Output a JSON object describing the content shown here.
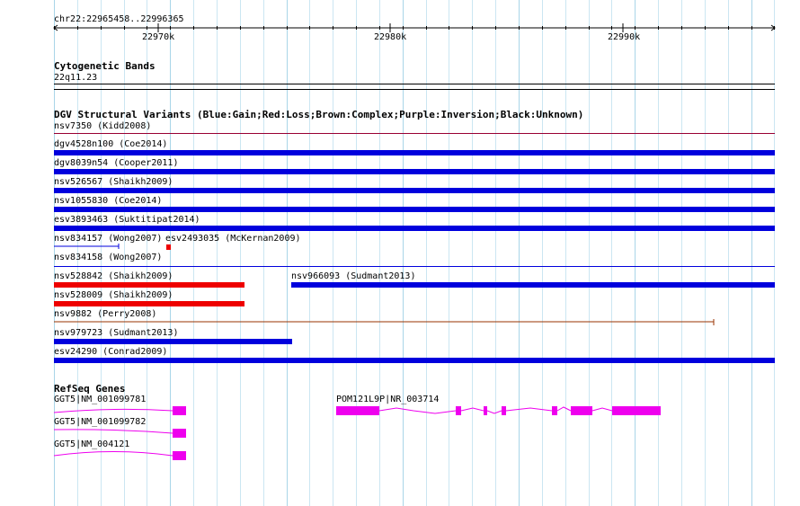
{
  "header": {
    "coords": "chr22:22965458..22996365"
  },
  "ruler": {
    "ticks": [
      "22970k",
      "22980k",
      "22990k"
    ]
  },
  "cytoband": {
    "title": "Cytogenetic Bands",
    "band": "22q11.23"
  },
  "dgv": {
    "title": "DGV Structural Variants (Blue:Gain;Red:Loss;Brown:Complex;Purple:Inversion;Black:Unknown)",
    "variants": [
      {
        "label": "nsv7350 (Kidd2008)",
        "color": "#990033"
      },
      {
        "label": "dgv4528n100 (Coe2014)",
        "color": "#0000dd"
      },
      {
        "label": "dgv8039n54 (Cooper2011)",
        "color": "#0000dd"
      },
      {
        "label": "nsv526567 (Shaikh2009)",
        "color": "#0000dd"
      },
      {
        "label": "nsv1055830 (Coe2014)",
        "color": "#0000dd"
      },
      {
        "label": "esv3893463 (Suktitipat2014)",
        "color": "#0000dd"
      },
      {
        "label": "nsv834157 (Wong2007)",
        "color": "#0000dd"
      },
      {
        "label": "esv2493035 (McKernan2009)",
        "color": "#ee0000"
      },
      {
        "label": "nsv834158 (Wong2007)",
        "color": "#0000dd"
      },
      {
        "label": "nsv528842 (Shaikh2009)",
        "color": "#ee0000"
      },
      {
        "label": "nsv966093 (Sudmant2013)",
        "color": "#0000dd"
      },
      {
        "label": "nsv528009 (Shaikh2009)",
        "color": "#ee0000"
      },
      {
        "label": "nsv9882 (Perry2008)",
        "color": "#993300"
      },
      {
        "label": "nsv979723 (Sudmant2013)",
        "color": "#0000dd"
      },
      {
        "label": "esv24290 (Conrad2009)",
        "color": "#0000dd"
      }
    ]
  },
  "refseq": {
    "title": "RefSeq Genes",
    "genes": [
      {
        "label": "GGT5|NM_001099781",
        "color": "#ee00ee"
      },
      {
        "label": "GGT5|NM_001099782",
        "color": "#ee00ee"
      },
      {
        "label": "GGT5|NM_004121",
        "color": "#ee00ee"
      },
      {
        "label": "POM121L9P|NR_003714",
        "color": "#ee00ee"
      }
    ]
  }
}
